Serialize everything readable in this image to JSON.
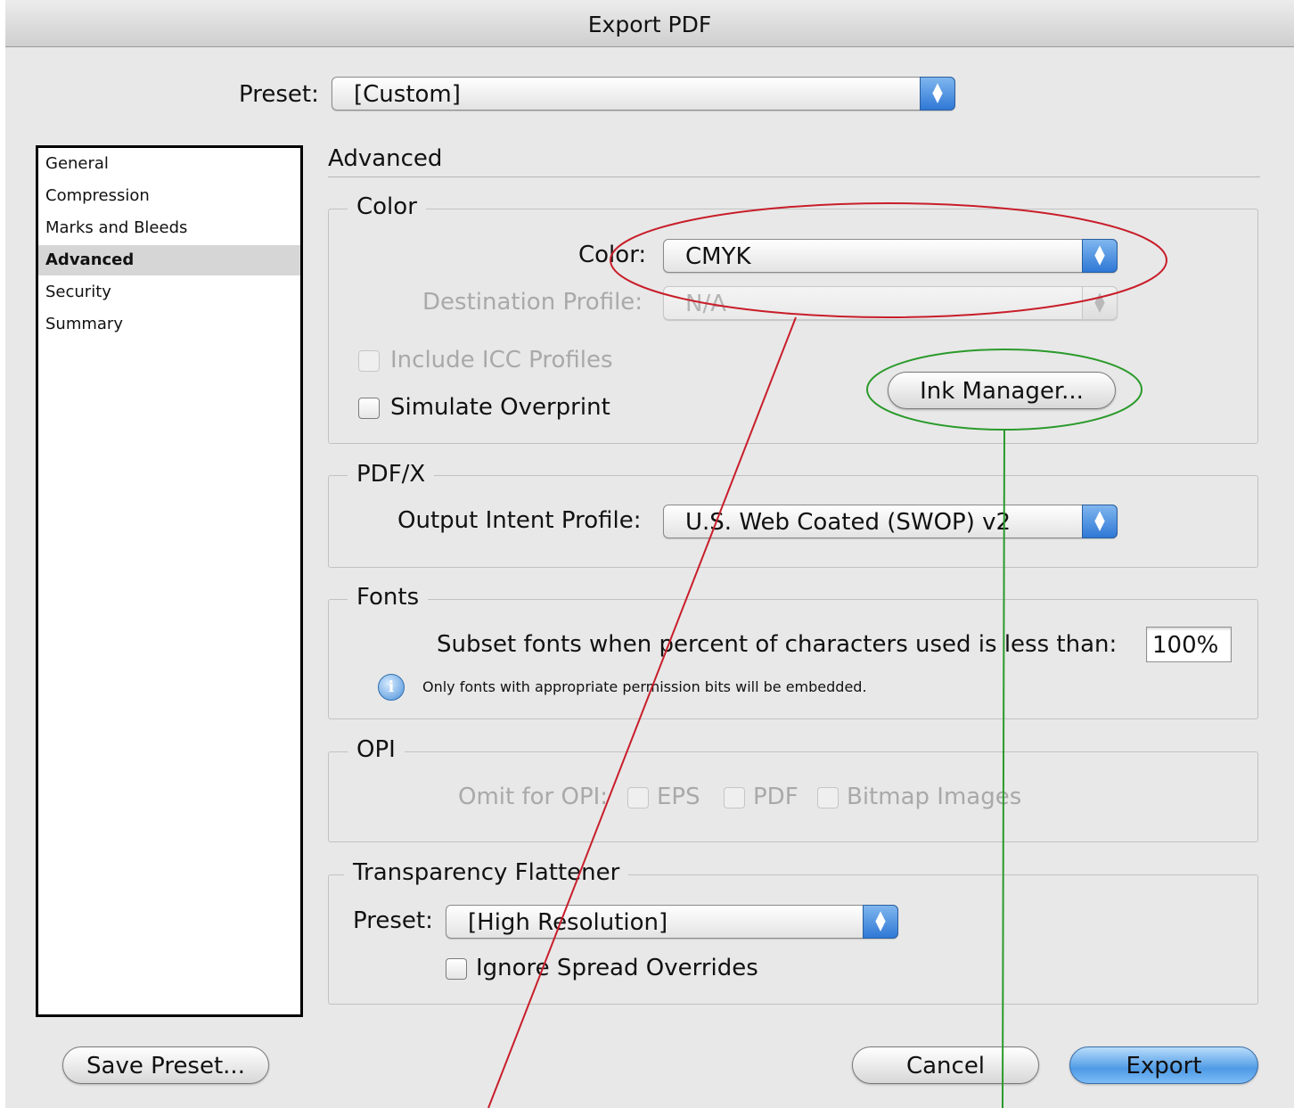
{
  "window": {
    "title": "Export PDF"
  },
  "preset": {
    "label": "Preset:",
    "value": "[Custom]"
  },
  "sidebar": {
    "items": [
      {
        "label": "General"
      },
      {
        "label": "Compression"
      },
      {
        "label": "Marks and Bleeds"
      },
      {
        "label": "Advanced",
        "selected": true
      },
      {
        "label": "Security"
      },
      {
        "label": "Summary"
      }
    ]
  },
  "panel": {
    "title": "Advanced"
  },
  "color_group": {
    "title": "Color",
    "color_label": "Color:",
    "color_value": "CMYK",
    "dest_label": "Destination Profile:",
    "dest_value": "N/A",
    "include_icc_label": "Include ICC Profiles",
    "simulate_overprint_label": "Simulate Overprint",
    "ink_manager_label": "Ink Manager..."
  },
  "pdfx_group": {
    "title": "PDF/X",
    "output_label": "Output Intent Profile:",
    "output_value": "U.S. Web Coated (SWOP) v2"
  },
  "fonts_group": {
    "title": "Fonts",
    "subset_label": "Subset fonts when percent of characters used is less than:",
    "subset_value": "100%",
    "info_text": "Only fonts with appropriate permission bits will be embedded."
  },
  "opi_group": {
    "title": "OPI",
    "omit_label": "Omit for OPI:",
    "eps_label": "EPS",
    "pdf_label": "PDF",
    "bitmap_label": "Bitmap Images"
  },
  "flattener_group": {
    "title": "Transparency Flattener",
    "preset_label": "Preset:",
    "preset_value": "[High Resolution]",
    "ignore_label": "Ignore Spread Overrides"
  },
  "buttons": {
    "save_preset": "Save Preset...",
    "cancel": "Cancel",
    "export": "Export"
  },
  "annotation_colors": {
    "red": "#c81e2a",
    "green": "#2a9a2a"
  }
}
